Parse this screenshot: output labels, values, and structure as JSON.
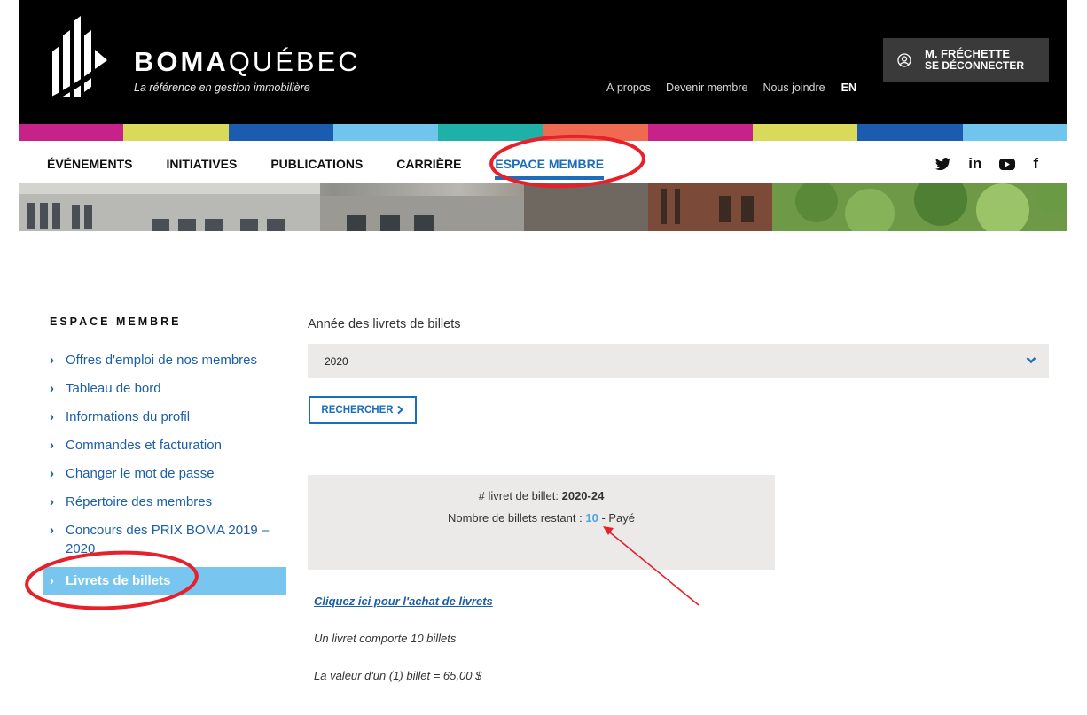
{
  "header": {
    "brand_bold": "BOMA",
    "brand_light": "QUÉBEC",
    "tagline": "La référence en gestion immobilière",
    "links": [
      "À propos",
      "Devenir membre",
      "Nous joindre"
    ],
    "lang": "EN",
    "user_name": "M. FRÉCHETTE",
    "logout": "SE DÉCONNECTER"
  },
  "strip_colors": [
    "#c7228a",
    "#d9da5a",
    "#1c5cb0",
    "#6fc5ec",
    "#1fb1a8",
    "#ef6a50",
    "#c7228a",
    "#d9da5a",
    "#1c5cb0",
    "#6fc5ec"
  ],
  "nav": {
    "items": [
      "ÉVÉNEMENTS",
      "INITIATIVES",
      "PUBLICATIONS",
      "CARRIÈRE",
      "ESPACE MEMBRE"
    ],
    "social_icons": [
      "twitter-icon",
      "linkedin-icon",
      "youtube-icon",
      "facebook-icon"
    ],
    "social_glyphs": [
      "𝕨",
      "in",
      "▶",
      "f"
    ]
  },
  "sidebar": {
    "title": "ESPACE MEMBRE",
    "items": [
      "Offres d'emploi de nos membres",
      "Tableau de bord",
      "Informations du profil",
      "Commandes et facturation",
      "Changer le mot de passe",
      "Répertoire des membres",
      "Concours des PRIX BOMA 2019 – 2020",
      "Livrets de billets"
    ]
  },
  "main": {
    "year_label": "Année des livrets de billets",
    "year_value": "2020",
    "search_label": "RECHERCHER",
    "booklet_label": "# livret de billet:",
    "booklet_number": "2020-24",
    "remaining_label": "Nombre de billets restant :",
    "remaining_count": "10",
    "paid_label": "- Payé",
    "buy_link": "Cliquez ici pour l'achat de livrets",
    "info1": "Un livret comporte 10 billets",
    "info2": "La valeur d'un (1) billet = 65,00 $"
  },
  "colors": {
    "accent_blue": "#1c6ebd",
    "sidebar_active": "#78c6f0",
    "annotation_red": "#e8202a"
  }
}
